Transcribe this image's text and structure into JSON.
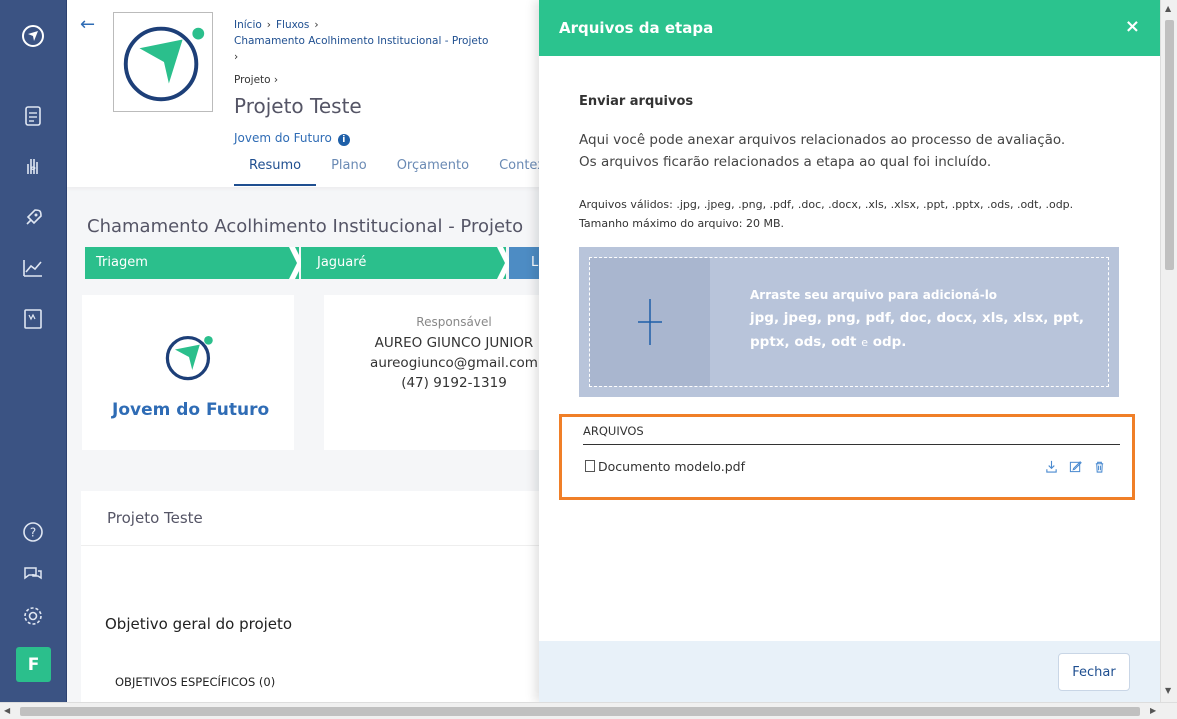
{
  "sidebar": {
    "icons": [
      "app-logo-icon",
      "document-icon",
      "hand-heart-icon",
      "rocket-icon",
      "chart-line-icon",
      "notebook-icon",
      "help-icon",
      "chat-icon",
      "gear-icon"
    ],
    "avatar_letter": "F"
  },
  "breadcrumb": {
    "items": [
      "Início",
      "Fluxos",
      "Chamamento Acolhimento Institucional - Projeto"
    ],
    "sub": "Projeto"
  },
  "project": {
    "title": "Projeto Teste",
    "org": "Jovem do Futuro"
  },
  "tabs": [
    "Resumo",
    "Plano",
    "Orçamento",
    "Contex"
  ],
  "main": {
    "section_title": "Chamamento Acolhimento Institucional - Projeto",
    "stages": [
      "Triagem",
      "Jaguaré",
      "Li"
    ],
    "org_card_title": "Jovem do Futuro",
    "responsible": {
      "label": "Responsável",
      "name": "AUREO GIUNCO JUNIOR",
      "email": "aureogiunco@gmail.com",
      "phone": "(47) 9192-1319"
    },
    "project_card_title": "Projeto Teste",
    "objective_title": "Objetivo geral do projeto",
    "objectives_specific": "OBJETIVOS ESPECÍFICOS (0)"
  },
  "panel": {
    "title": "Arquivos da etapa",
    "close_symbol": "×",
    "send_title": "Enviar arquivos",
    "send_desc": "Aqui você pode anexar arquivos relacionados ao processo de avaliação. Os arquivos ficarão relacionados a etapa ao qual foi incluído.",
    "valid_types": "Arquivos válidos: .jpg, .jpeg, .png, .pdf, .doc, .docx, .xls, .xlsx, .ppt, .pptx, .ods, .odt, .odp.",
    "max_size": "Tamanho máximo do arquivo: 20 MB.",
    "dropzone": {
      "line1": "Arraste seu arquivo para adicioná-lo",
      "line2": "jpg, jpeg, png, pdf, doc, docx, xls, xlsx, ppt, pptx, ods, odt",
      "line2_e": "e",
      "line2_end": "odp."
    },
    "files_header": "ARQUIVOS",
    "files": [
      {
        "name": "Documento modelo.pdf"
      }
    ],
    "close_button": "Fechar"
  },
  "colors": {
    "sidebar": "#3b5383",
    "accent_green": "#2bc38e",
    "highlight": "#f07f28",
    "link_blue": "#1f4f90"
  }
}
